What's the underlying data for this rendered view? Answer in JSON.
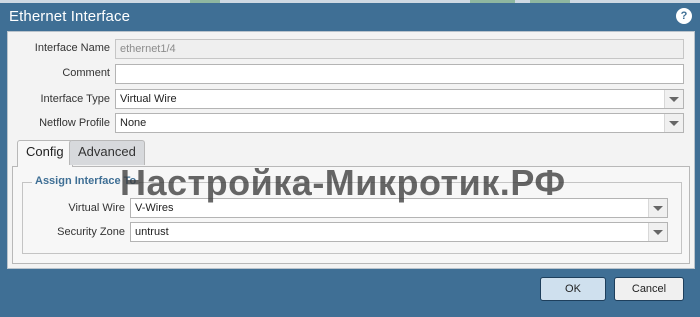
{
  "window": {
    "title": "Ethernet Interface",
    "help_icon": "?"
  },
  "form": {
    "interface_name": {
      "label": "Interface Name",
      "value": "ethernet1/4"
    },
    "comment": {
      "label": "Comment",
      "value": ""
    },
    "interface_type": {
      "label": "Interface Type",
      "value": "Virtual Wire"
    },
    "netflow_profile": {
      "label": "Netflow Profile",
      "value": "None"
    }
  },
  "tabs": [
    {
      "label": "Config",
      "active": true
    },
    {
      "label": "Advanced",
      "active": false
    }
  ],
  "assign": {
    "legend": "Assign Interface To",
    "virtual_wire": {
      "label": "Virtual Wire",
      "value": "V-Wires"
    },
    "security_zone": {
      "label": "Security Zone",
      "value": "untrust"
    }
  },
  "buttons": {
    "ok": "OK",
    "cancel": "Cancel"
  },
  "watermark": "Настройка-Микротик.РФ",
  "colors": {
    "title_bar": "#3f6f95",
    "legend_text": "#3f6f95",
    "ok_button": "#cfe0ee"
  }
}
